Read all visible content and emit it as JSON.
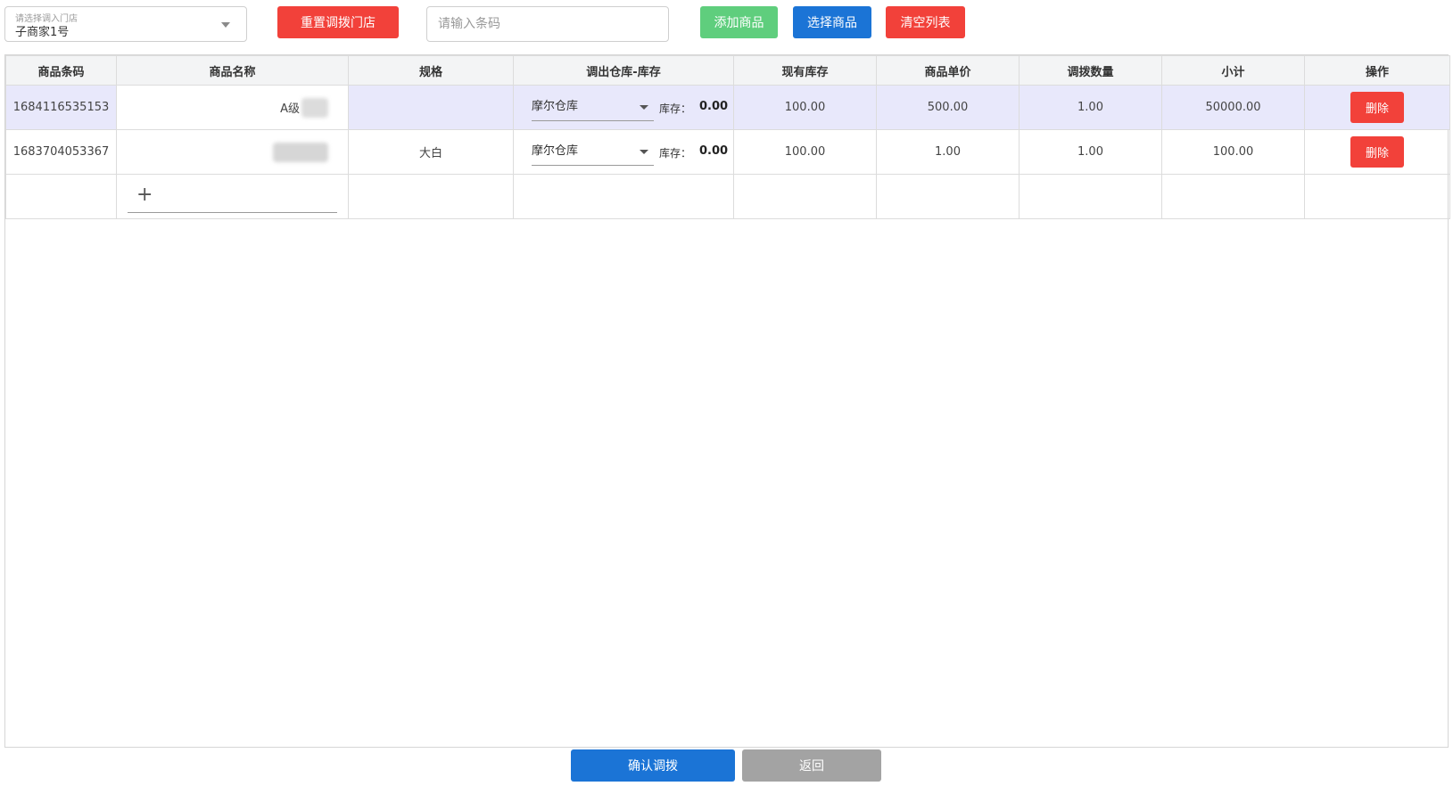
{
  "toolbar": {
    "store_placeholder": "请选择调入门店",
    "store_value": "子商家1号",
    "reset_store_label": "重置调拨门店",
    "barcode_placeholder": "请输入条码",
    "add_product_label": "添加商品",
    "select_product_label": "选择商品",
    "clear_list_label": "清空列表"
  },
  "table": {
    "headers": [
      "商品条码",
      "商品名称",
      "规格",
      "调出仓库-库存",
      "现有库存",
      "商品单价",
      "调拨数量",
      "小计",
      "操作"
    ],
    "stock_label": "库存：",
    "delete_label": "删除",
    "rows": [
      {
        "barcode": "1684116535153",
        "name": "A级",
        "spec": "",
        "warehouse": "摩尔仓库",
        "warehouse_stock": "0.00",
        "current_stock": "100.00",
        "unit_price": "500.00",
        "quantity": "1.00",
        "subtotal": "50000.00"
      },
      {
        "barcode": "1683704053367",
        "name": "",
        "spec": "大白",
        "warehouse": "摩尔仓库",
        "warehouse_stock": "0.00",
        "current_stock": "100.00",
        "unit_price": "1.00",
        "quantity": "1.00",
        "subtotal": "100.00"
      }
    ],
    "add_row_symbol": "+"
  },
  "footer": {
    "confirm_label": "确认调拨",
    "back_label": "返回"
  },
  "colors": {
    "red": "#f2413a",
    "green": "#5fce7d",
    "blue": "#1b74d6",
    "grey": "#a3a3a3",
    "row_highlight": "#e8e8fb"
  }
}
